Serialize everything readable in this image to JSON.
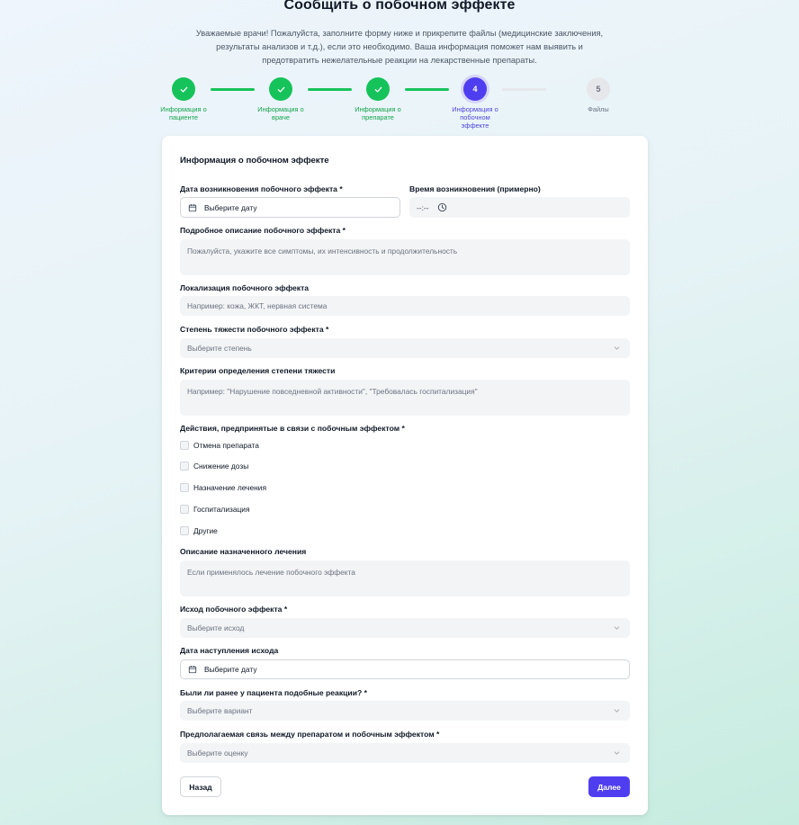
{
  "page": {
    "title": "Сообщить о побочном эффекте",
    "intro": "Уважаемые врачи! Пожалуйста, заполните форму ниже и прикрепите файлы (медицинские заключения, результаты анализов и т.д.), если это необходимо. Ваша информация поможет нам выявить и предотвратить нежелательные реакции на лекарственные препараты."
  },
  "stepper": {
    "steps": [
      {
        "number": "1",
        "label": "Информация о пациенте",
        "status": "done"
      },
      {
        "number": "2",
        "label": "Информация о враче",
        "status": "done"
      },
      {
        "number": "3",
        "label": "Информация о препарате",
        "status": "done"
      },
      {
        "number": "4",
        "label": "Информация о побочном эффекте",
        "status": "active"
      },
      {
        "number": "5",
        "label": "Файлы",
        "status": "pending"
      }
    ],
    "colors": {
      "done": "#16c35a",
      "active": "#4f3ef0",
      "pending": "#e5e7eb"
    }
  },
  "form": {
    "section_title": "Информация о побочном эффекте",
    "onset_date": {
      "label": "Дата возникновения побочного эффекта *",
      "placeholder": "Выберите дату",
      "icon": "calendar-icon"
    },
    "onset_time": {
      "label": "Время возникновения (примерно)",
      "value": "--:--",
      "icon": "clock-icon"
    },
    "description": {
      "label": "Подробное описание побочного эффекта *",
      "placeholder": "Пожалуйста, укажите все симптомы, их интенсивность и продолжительность"
    },
    "localization": {
      "label": "Локализация побочного эффекта",
      "placeholder": "Например: кожа, ЖКТ, нервная система"
    },
    "severity": {
      "label": "Степень тяжести побочного эффекта *",
      "placeholder": "Выберите степень",
      "icon": "chevron-down-icon"
    },
    "severity_criteria": {
      "label": "Критерии определения степени тяжести",
      "placeholder": "Например: \"Нарушение повседневной активности\", \"Требовалась госпитализация\""
    },
    "actions": {
      "label": "Действия, предпринятые в связи с побочным эффектом *",
      "options": [
        {
          "label": "Отмена препарата",
          "checked": false
        },
        {
          "label": "Снижение дозы",
          "checked": false
        },
        {
          "label": "Назначение лечения",
          "checked": false
        },
        {
          "label": "Госпитализация",
          "checked": false
        },
        {
          "label": "Другие",
          "checked": false
        }
      ]
    },
    "treatment_description": {
      "label": "Описание назначенного лечения",
      "placeholder": "Если применялось лечение побочного эффекта"
    },
    "outcome": {
      "label": "Исход побочного эффекта *",
      "placeholder": "Выберите исход"
    },
    "outcome_date": {
      "label": "Дата наступления исхода",
      "placeholder": "Выберите дату"
    },
    "previous_reactions": {
      "label": "Были ли ранее у пациента подобные реакции? *",
      "placeholder": "Выберите вариант"
    },
    "causality": {
      "label": "Предполагаемая связь между препаратом и побочным эффектом *",
      "placeholder": "Выберите оценку"
    }
  },
  "buttons": {
    "back": "Назад",
    "next": "Далее"
  },
  "colors": {
    "accent": "#4f3ef0",
    "success": "#16c35a",
    "field_bg": "#f3f4f6"
  }
}
